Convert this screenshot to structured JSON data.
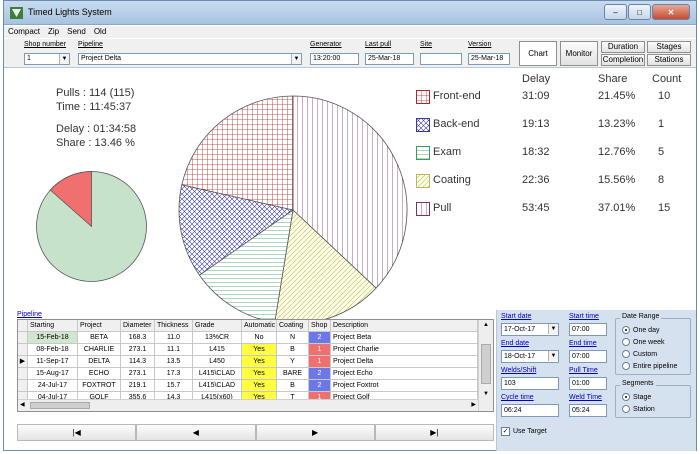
{
  "window": {
    "title": "Timed Lights System"
  },
  "menu": [
    "Compact",
    "Zip",
    "Send",
    "Old"
  ],
  "toolbar": {
    "shop_label": "Shop number",
    "shop_value": "1",
    "pipeline_label": "Pipeline",
    "pipeline_value": "Project Delta",
    "generator_label": "Generator",
    "generator_value": "13:20:00",
    "lastpull_label": "Last pull",
    "lastpull_value": "25-Mar-18",
    "site_label": "Site",
    "site_value": "",
    "version_label": "Version",
    "version_value": "25-Mar-18",
    "buttons": {
      "chart": "Chart",
      "monitor": "Monitor",
      "duration": "Duration",
      "completion": "Completion",
      "stages": "Stages",
      "stations": "Stations"
    }
  },
  "stats": {
    "pulls": "Pulls  : 114 (115)",
    "time": "Time   : 11:45:37",
    "delay": "Delay  : 01:34:58",
    "share": "Share  : 13.46 %"
  },
  "legend": {
    "headers": {
      "delay": "Delay",
      "share": "Share",
      "count": "Count"
    },
    "items": [
      {
        "label": "Front-end",
        "delay": "31:09",
        "share": "21.45%",
        "count": "10",
        "color": "#b22222",
        "pattern": "grid"
      },
      {
        "label": "Back-end",
        "delay": "19:13",
        "share": "13.23%",
        "count": "1",
        "color": "#3a3a9a",
        "pattern": "crosshatch"
      },
      {
        "label": "Exam",
        "delay": "18:32",
        "share": "12.76%",
        "count": "5",
        "color": "#3a9a5a",
        "pattern": "horizontal"
      },
      {
        "label": "Coating",
        "delay": "22:36",
        "share": "15.56%",
        "count": "8",
        "color": "#b8b860",
        "pattern": "diagonal"
      },
      {
        "label": "Pull",
        "delay": "53:45",
        "share": "37.01%",
        "count": "15",
        "color": "#7a3060",
        "pattern": "vertical"
      }
    ]
  },
  "small_pie": {
    "share_pct": 13.46,
    "highlight_color": "#f07070",
    "base_color": "#c6e2ca"
  },
  "grid": {
    "label": "Pipeline",
    "columns": [
      "Starting",
      "Project",
      "Diameter",
      "Thickness",
      "Grade",
      "Automatic",
      "Coating",
      "Shop",
      "Description"
    ],
    "rows": [
      {
        "starting": "15-Feb-18",
        "project": "BETA",
        "diameter": "168.3",
        "thickness": "11.0",
        "grade": "13%CR",
        "automatic": "No",
        "coating": "N",
        "shop": "2",
        "description": "Project Beta"
      },
      {
        "starting": "08-Feb-18",
        "project": "CHARLIE",
        "diameter": "273.1",
        "thickness": "11.1",
        "grade": "L415",
        "automatic": "Yes",
        "coating": "B",
        "shop": "1",
        "description": "Project Charlie"
      },
      {
        "starting": "11-Sep-17",
        "project": "DELTA",
        "diameter": "114.3",
        "thickness": "13.5",
        "grade": "L450",
        "automatic": "Yes",
        "coating": "Y",
        "shop": "1",
        "description": "Project Delta"
      },
      {
        "starting": "15-Aug-17",
        "project": "ECHO",
        "diameter": "273.1",
        "thickness": "17.3",
        "grade": "L415\\CLAD",
        "automatic": "Yes",
        "coating": "BARE",
        "shop": "2",
        "description": "Project Echo"
      },
      {
        "starting": "24-Jul-17",
        "project": "FOXTROT",
        "diameter": "219.1",
        "thickness": "15.7",
        "grade": "L415\\CLAD",
        "automatic": "Yes",
        "coating": "B",
        "shop": "2",
        "description": "Project Foxtrot"
      },
      {
        "starting": "04-Jul-17",
        "project": "GOLF",
        "diameter": "355.6",
        "thickness": "14.3",
        "grade": "L415(x60)",
        "automatic": "Yes",
        "coating": "T",
        "shop": "1",
        "description": "Project Golf"
      }
    ],
    "current_row_marker": "▶"
  },
  "nav": {
    "first": "|◀",
    "prev": "◀",
    "next": "▶",
    "last": "▶|"
  },
  "filters": {
    "start_date_label": "Start date",
    "start_date": "17-Oct-17",
    "start_time_label": "Start time",
    "start_time": "07:00",
    "end_date_label": "End date",
    "end_date": "18-Oct-17",
    "end_time_label": "End time",
    "end_time": "07:00",
    "welds_label": "Welds/Shift",
    "welds": "103",
    "pulltime_label": "Pull Time",
    "pulltime": "01:00",
    "cycle_label": "Cycle time",
    "cycle": "06:24",
    "weldtime_label": "Weld Time",
    "weldtime": "05:24",
    "date_range_title": "Date Range",
    "date_range_options": [
      "One day",
      "One week",
      "Custom",
      "Entire pipeline"
    ],
    "segments_title": "Segments",
    "segments_options": [
      "Stage",
      "Station"
    ],
    "use_target": "Use Target"
  }
}
